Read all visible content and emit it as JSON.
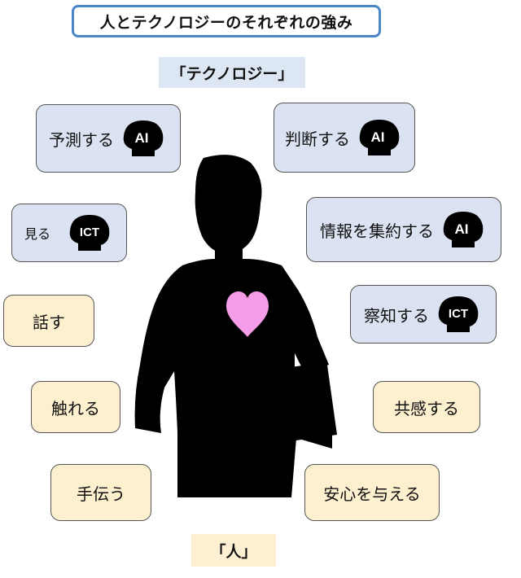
{
  "title": "人とテクノロジーのそれぞれの強み",
  "tech_label": "「テクノロジー」",
  "human_label": "「人」",
  "tech_items": [
    {
      "label": "予測する",
      "badge": "AI"
    },
    {
      "label": "判断する",
      "badge": "AI"
    },
    {
      "label": "見る",
      "badge": "ICT"
    },
    {
      "label": "情報を集約する",
      "badge": "AI"
    },
    {
      "label": "察知する",
      "badge": "ICT"
    }
  ],
  "human_items": [
    {
      "label": "話す"
    },
    {
      "label": "触れる"
    },
    {
      "label": "共感する"
    },
    {
      "label": "手伝う"
    },
    {
      "label": "安心を与える"
    }
  ],
  "colors": {
    "title_border": "#4a86c8",
    "tech_fill": "#dbe3f2",
    "human_fill": "#fdf0cf",
    "heart": "#f59ce8",
    "silhouette": "#000000"
  },
  "icons": {
    "head": "head-silhouette-icon",
    "heart": "heart-icon",
    "person": "person-silhouette-icon"
  }
}
